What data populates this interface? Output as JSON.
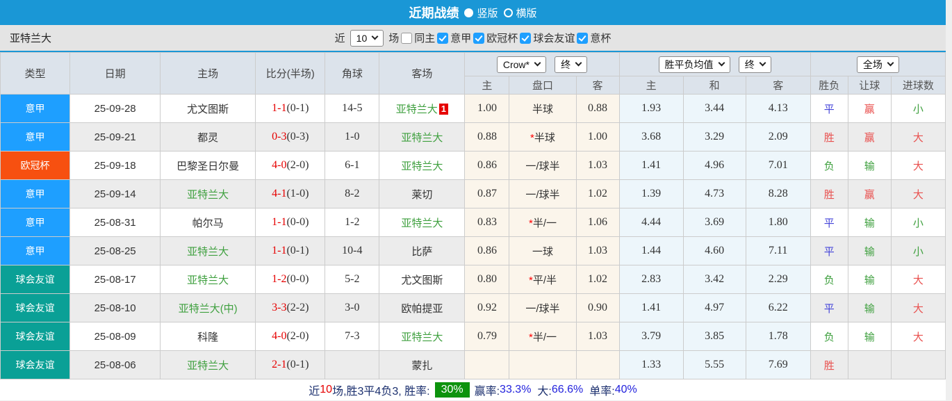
{
  "title_bar": {
    "title": "近期战绩",
    "radio_vertical": "竖版",
    "radio_horizontal": "横版"
  },
  "toolbar": {
    "team": "亚特兰大",
    "recent_label": "近",
    "recent_value": "10",
    "games_label": "场",
    "same_home_label": "同主",
    "filters": [
      {
        "label": "意甲",
        "checked": true
      },
      {
        "label": "欧冠杯",
        "checked": true
      },
      {
        "label": "球会友谊",
        "checked": true
      },
      {
        "label": "意杯",
        "checked": true
      }
    ]
  },
  "table": {
    "headers": [
      "类型",
      "日期",
      "主场",
      "比分(半场)",
      "角球",
      "客场"
    ],
    "dropdowns": {
      "company": "Crow*",
      "company_time": "终",
      "europe": "胜平负均值",
      "europe_time": "终",
      "scope": "全场"
    },
    "subheaders": [
      "主",
      "盘口",
      "客",
      "主",
      "和",
      "客",
      "胜负",
      "让球",
      "进球数"
    ],
    "rows": [
      {
        "type": "意甲",
        "type_key": "serie-a",
        "date": "25-09-28",
        "home": "尤文图斯",
        "home_is_team": false,
        "score": "1-1",
        "half": "(0-1)",
        "corners": "14-5",
        "away": "亚特兰大",
        "away_is_team": true,
        "away_badge": "1",
        "asia_home": "1.00",
        "handicap": "半球",
        "handicap_star": false,
        "asia_away": "0.88",
        "euro_home": "1.93",
        "euro_draw": "3.44",
        "euro_away": "4.13",
        "result": "平",
        "result_key": "draw",
        "spread": "赢",
        "spread_key": "win",
        "goals": "小",
        "goals_key": "small"
      },
      {
        "type": "意甲",
        "type_key": "serie-a",
        "date": "25-09-21",
        "home": "都灵",
        "home_is_team": false,
        "score": "0-3",
        "half": "(0-3)",
        "corners": "1-0",
        "away": "亚特兰大",
        "away_is_team": true,
        "away_badge": "",
        "asia_home": "0.88",
        "handicap": "半球",
        "handicap_star": true,
        "asia_away": "1.00",
        "euro_home": "3.68",
        "euro_draw": "3.29",
        "euro_away": "2.09",
        "result": "胜",
        "result_key": "win",
        "spread": "赢",
        "spread_key": "win",
        "goals": "大",
        "goals_key": "big"
      },
      {
        "type": "欧冠杯",
        "type_key": "ucl",
        "date": "25-09-18",
        "home": "巴黎圣日尔曼",
        "home_is_team": false,
        "score": "4-0",
        "half": "(2-0)",
        "corners": "6-1",
        "away": "亚特兰大",
        "away_is_team": true,
        "away_badge": "",
        "asia_home": "0.86",
        "handicap": "一/球半",
        "handicap_star": false,
        "asia_away": "1.03",
        "euro_home": "1.41",
        "euro_draw": "4.96",
        "euro_away": "7.01",
        "result": "负",
        "result_key": "lose",
        "spread": "输",
        "spread_key": "lose",
        "goals": "大",
        "goals_key": "big"
      },
      {
        "type": "意甲",
        "type_key": "serie-a",
        "date": "25-09-14",
        "home": "亚特兰大",
        "home_is_team": true,
        "score": "4-1",
        "half": "(1-0)",
        "corners": "8-2",
        "away": "莱切",
        "away_is_team": false,
        "away_badge": "",
        "asia_home": "0.87",
        "handicap": "一/球半",
        "handicap_star": false,
        "asia_away": "1.02",
        "euro_home": "1.39",
        "euro_draw": "4.73",
        "euro_away": "8.28",
        "result": "胜",
        "result_key": "win",
        "spread": "赢",
        "spread_key": "win",
        "goals": "大",
        "goals_key": "big"
      },
      {
        "type": "意甲",
        "type_key": "serie-a",
        "date": "25-08-31",
        "home": "帕尔马",
        "home_is_team": false,
        "score": "1-1",
        "half": "(0-0)",
        "corners": "1-2",
        "away": "亚特兰大",
        "away_is_team": true,
        "away_badge": "",
        "asia_home": "0.83",
        "handicap": "半/一",
        "handicap_star": true,
        "asia_away": "1.06",
        "euro_home": "4.44",
        "euro_draw": "3.69",
        "euro_away": "1.80",
        "result": "平",
        "result_key": "draw",
        "spread": "输",
        "spread_key": "lose",
        "goals": "小",
        "goals_key": "small"
      },
      {
        "type": "意甲",
        "type_key": "serie-a",
        "date": "25-08-25",
        "home": "亚特兰大",
        "home_is_team": true,
        "score": "1-1",
        "half": "(0-1)",
        "corners": "10-4",
        "away": "比萨",
        "away_is_team": false,
        "away_badge": "",
        "asia_home": "0.86",
        "handicap": "一球",
        "handicap_star": false,
        "asia_away": "1.03",
        "euro_home": "1.44",
        "euro_draw": "4.60",
        "euro_away": "7.11",
        "result": "平",
        "result_key": "draw",
        "spread": "输",
        "spread_key": "lose",
        "goals": "小",
        "goals_key": "small"
      },
      {
        "type": "球会友谊",
        "type_key": "friendly",
        "date": "25-08-17",
        "home": "亚特兰大",
        "home_is_team": true,
        "score": "1-2",
        "half": "(0-0)",
        "corners": "5-2",
        "away": "尤文图斯",
        "away_is_team": false,
        "away_badge": "",
        "asia_home": "0.80",
        "handicap": "平/半",
        "handicap_star": true,
        "asia_away": "1.02",
        "euro_home": "2.83",
        "euro_draw": "3.42",
        "euro_away": "2.29",
        "result": "负",
        "result_key": "lose",
        "spread": "输",
        "spread_key": "lose",
        "goals": "大",
        "goals_key": "big"
      },
      {
        "type": "球会友谊",
        "type_key": "friendly",
        "date": "25-08-10",
        "home": "亚特兰大(中)",
        "home_is_team": true,
        "score": "3-3",
        "half": "(2-2)",
        "corners": "3-0",
        "away": "欧帕提亚",
        "away_is_team": false,
        "away_badge": "",
        "asia_home": "0.92",
        "handicap": "一/球半",
        "handicap_star": false,
        "asia_away": "0.90",
        "euro_home": "1.41",
        "euro_draw": "4.97",
        "euro_away": "6.22",
        "result": "平",
        "result_key": "draw",
        "spread": "输",
        "spread_key": "lose",
        "goals": "大",
        "goals_key": "big"
      },
      {
        "type": "球会友谊",
        "type_key": "friendly",
        "date": "25-08-09",
        "home": "科隆",
        "home_is_team": false,
        "score": "4-0",
        "half": "(2-0)",
        "corners": "7-3",
        "away": "亚特兰大",
        "away_is_team": true,
        "away_badge": "",
        "asia_home": "0.79",
        "handicap": "半/一",
        "handicap_star": true,
        "asia_away": "1.03",
        "euro_home": "3.79",
        "euro_draw": "3.85",
        "euro_away": "1.78",
        "result": "负",
        "result_key": "lose",
        "spread": "输",
        "spread_key": "lose",
        "goals": "大",
        "goals_key": "big"
      },
      {
        "type": "球会友谊",
        "type_key": "friendly",
        "date": "25-08-06",
        "home": "亚特兰大",
        "home_is_team": true,
        "score": "2-1",
        "half": "(0-1)",
        "corners": "",
        "away": "蒙扎",
        "away_is_team": false,
        "away_badge": "",
        "asia_home": "",
        "handicap": "",
        "handicap_star": false,
        "asia_away": "",
        "euro_home": "1.33",
        "euro_draw": "5.55",
        "euro_away": "7.69",
        "result": "胜",
        "result_key": "win",
        "spread": "",
        "spread_key": "",
        "goals": "",
        "goals_key": ""
      }
    ]
  },
  "summary": {
    "prefix": "近",
    "count": "10",
    "middle": "场,胜3平4负3, 胜率:",
    "win_rate": "30%",
    "stats": [
      {
        "label": "赢率:",
        "value": "33.3%"
      },
      {
        "label": "大:",
        "value": "66.6%"
      },
      {
        "label": "单率:",
        "value": "40%"
      }
    ]
  },
  "colors": {
    "accent_blue": "#1a97d6",
    "serie_a": "#1e9fff",
    "ucl": "#f75010",
    "friendly": "#0aa096",
    "team_green": "#3fa03f",
    "score_red": "#e60000",
    "win_red": "#e9504e",
    "draw_blue": "#4444d9",
    "lose_green": "#3fa03f",
    "rate_green": "#0d930d"
  }
}
